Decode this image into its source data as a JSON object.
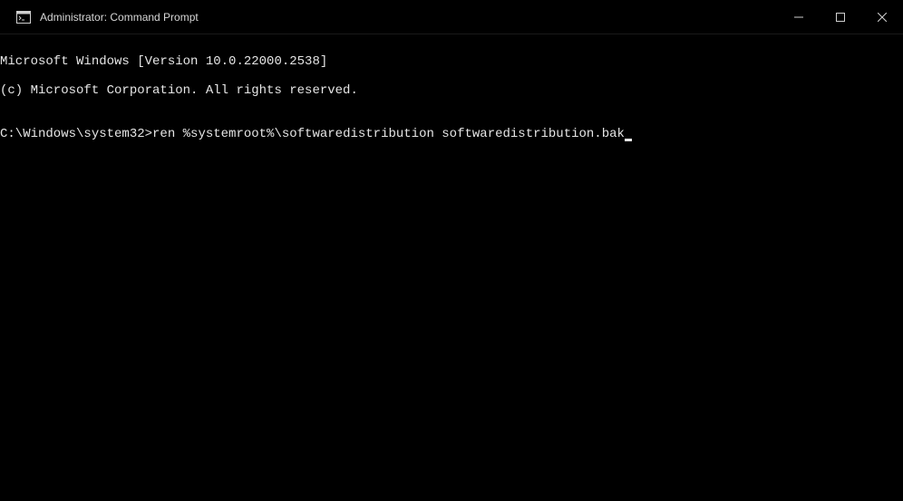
{
  "titlebar": {
    "title": "Administrator: Command Prompt"
  },
  "terminal": {
    "line1": "Microsoft Windows [Version 10.0.22000.2538]",
    "line2": "(c) Microsoft Corporation. All rights reserved.",
    "blank": "",
    "prompt": "C:\\Windows\\system32>",
    "command": "ren %systemroot%\\softwaredistribution softwaredistribution.bak"
  }
}
